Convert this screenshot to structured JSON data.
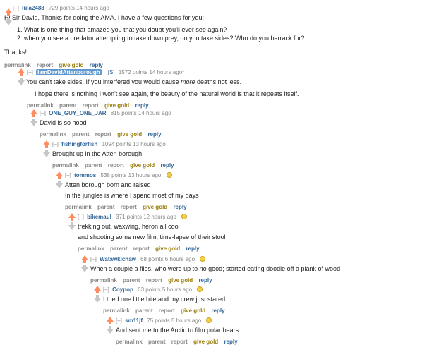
{
  "colors": {
    "upvote": "#ff8b60",
    "downvote": "#c6c6c6",
    "author": "#336699",
    "op_highlight": "#5f99cf",
    "gold": "#9a7d0a"
  },
  "buttons": {
    "permalink": "permalink",
    "parent": "parent",
    "report": "report",
    "give_gold": "give gold",
    "reply": "reply"
  },
  "expand_label": "[–]",
  "comments": [
    {
      "author": "lula2488",
      "score": "729 points",
      "time": "14 hours ago",
      "lines": [
        "Hi Sir David, Thanks for doing the AMA, I have a few questions for you:"
      ],
      "list": [
        "What is one thing that amazed you that you doubt you'll ever see again?",
        "when you see a predator attempting to take down prey, do you take sides? Who do you barrack for?"
      ],
      "after": "Thanks!"
    },
    {
      "author": "IamDavidAttenborough",
      "flair": "[S]",
      "score": "1572 points",
      "time": "14 hours ago*",
      "line1_before": "You can't take sides. If you interfered you would cause ",
      "line1_em": "more",
      "line1_after": " deaths not less.",
      "line2": "I hope there is nothing I won't see again, the beauty of the natural world is that it repeats itself."
    },
    {
      "author": "ONE_GUY_ONE_JAR",
      "score": "815 points",
      "time": "14 hours ago",
      "line1": "David is so hood"
    },
    {
      "author": "fishingforfish",
      "score": "1094 points",
      "time": "13 hours ago",
      "line1": "Brought up in the Atten borough"
    },
    {
      "author": "tommos",
      "score": "538 points",
      "time": "13 hours ago",
      "line1": "Atten borough born and raised",
      "line2": "In the jungles is where I spend most of my days"
    },
    {
      "author": "bikemaul",
      "score": "371 points",
      "time": "12 hours ago",
      "line1": "trekking out, waxwing, heron all cool",
      "line2": "and shooting some new film, time-lapse of their stool"
    },
    {
      "author": "Watawkichaw",
      "score": "68 points",
      "time": "6 hours ago",
      "line1": "When a couple a flies, who were up to no good; started eating doodie off a plank of wood"
    },
    {
      "author": "Coypop",
      "score": "63 points",
      "time": "5 hours ago",
      "line1": "I tried one little bite and my crew just stared"
    },
    {
      "author": "sm11jf",
      "score": "75 points",
      "time": "5 hours ago",
      "line1": "And sent me to the Arctic to film polar bears"
    }
  ]
}
